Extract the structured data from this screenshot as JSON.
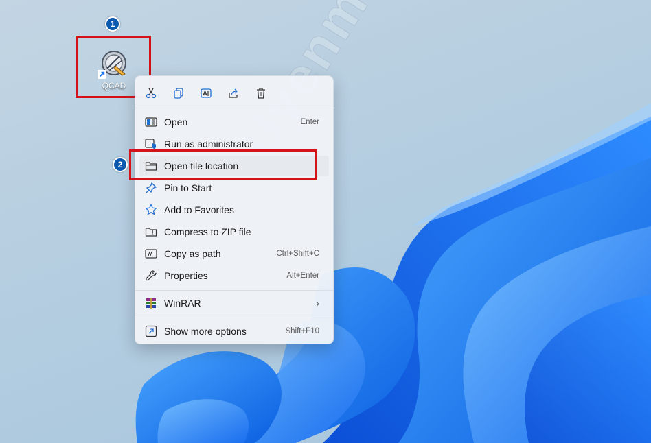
{
  "desktop": {
    "icon_label": "QCAD"
  },
  "annotations": {
    "step1": "1",
    "step2": "2"
  },
  "watermark": "Uyenmix",
  "toolbar_icons": [
    "cut-icon",
    "copy-icon",
    "rename-icon",
    "share-icon",
    "delete-icon"
  ],
  "menu": {
    "items": [
      {
        "label": "Open",
        "shortcut": "Enter",
        "icon": "open-icon"
      },
      {
        "label": "Run as administrator",
        "shortcut": "",
        "icon": "shield-icon"
      },
      {
        "label": "Open file location",
        "shortcut": "",
        "icon": "folder-icon"
      },
      {
        "label": "Pin to Start",
        "shortcut": "",
        "icon": "pin-icon"
      },
      {
        "label": "Add to Favorites",
        "shortcut": "",
        "icon": "star-icon"
      },
      {
        "label": "Compress to ZIP file",
        "shortcut": "",
        "icon": "zip-folder-icon"
      },
      {
        "label": "Copy as path",
        "shortcut": "Ctrl+Shift+C",
        "icon": "path-icon"
      },
      {
        "label": "Properties",
        "shortcut": "Alt+Enter",
        "icon": "wrench-icon"
      }
    ],
    "winrar": {
      "label": "WinRAR",
      "chevron": "›",
      "icon": "winrar-icon"
    },
    "more": {
      "label": "Show more options",
      "shortcut": "Shift+F10",
      "icon": "more-options-icon"
    }
  },
  "colors": {
    "highlight": "#d4121a",
    "badge": "#0a5bb0",
    "accent": "#1a73e8"
  }
}
